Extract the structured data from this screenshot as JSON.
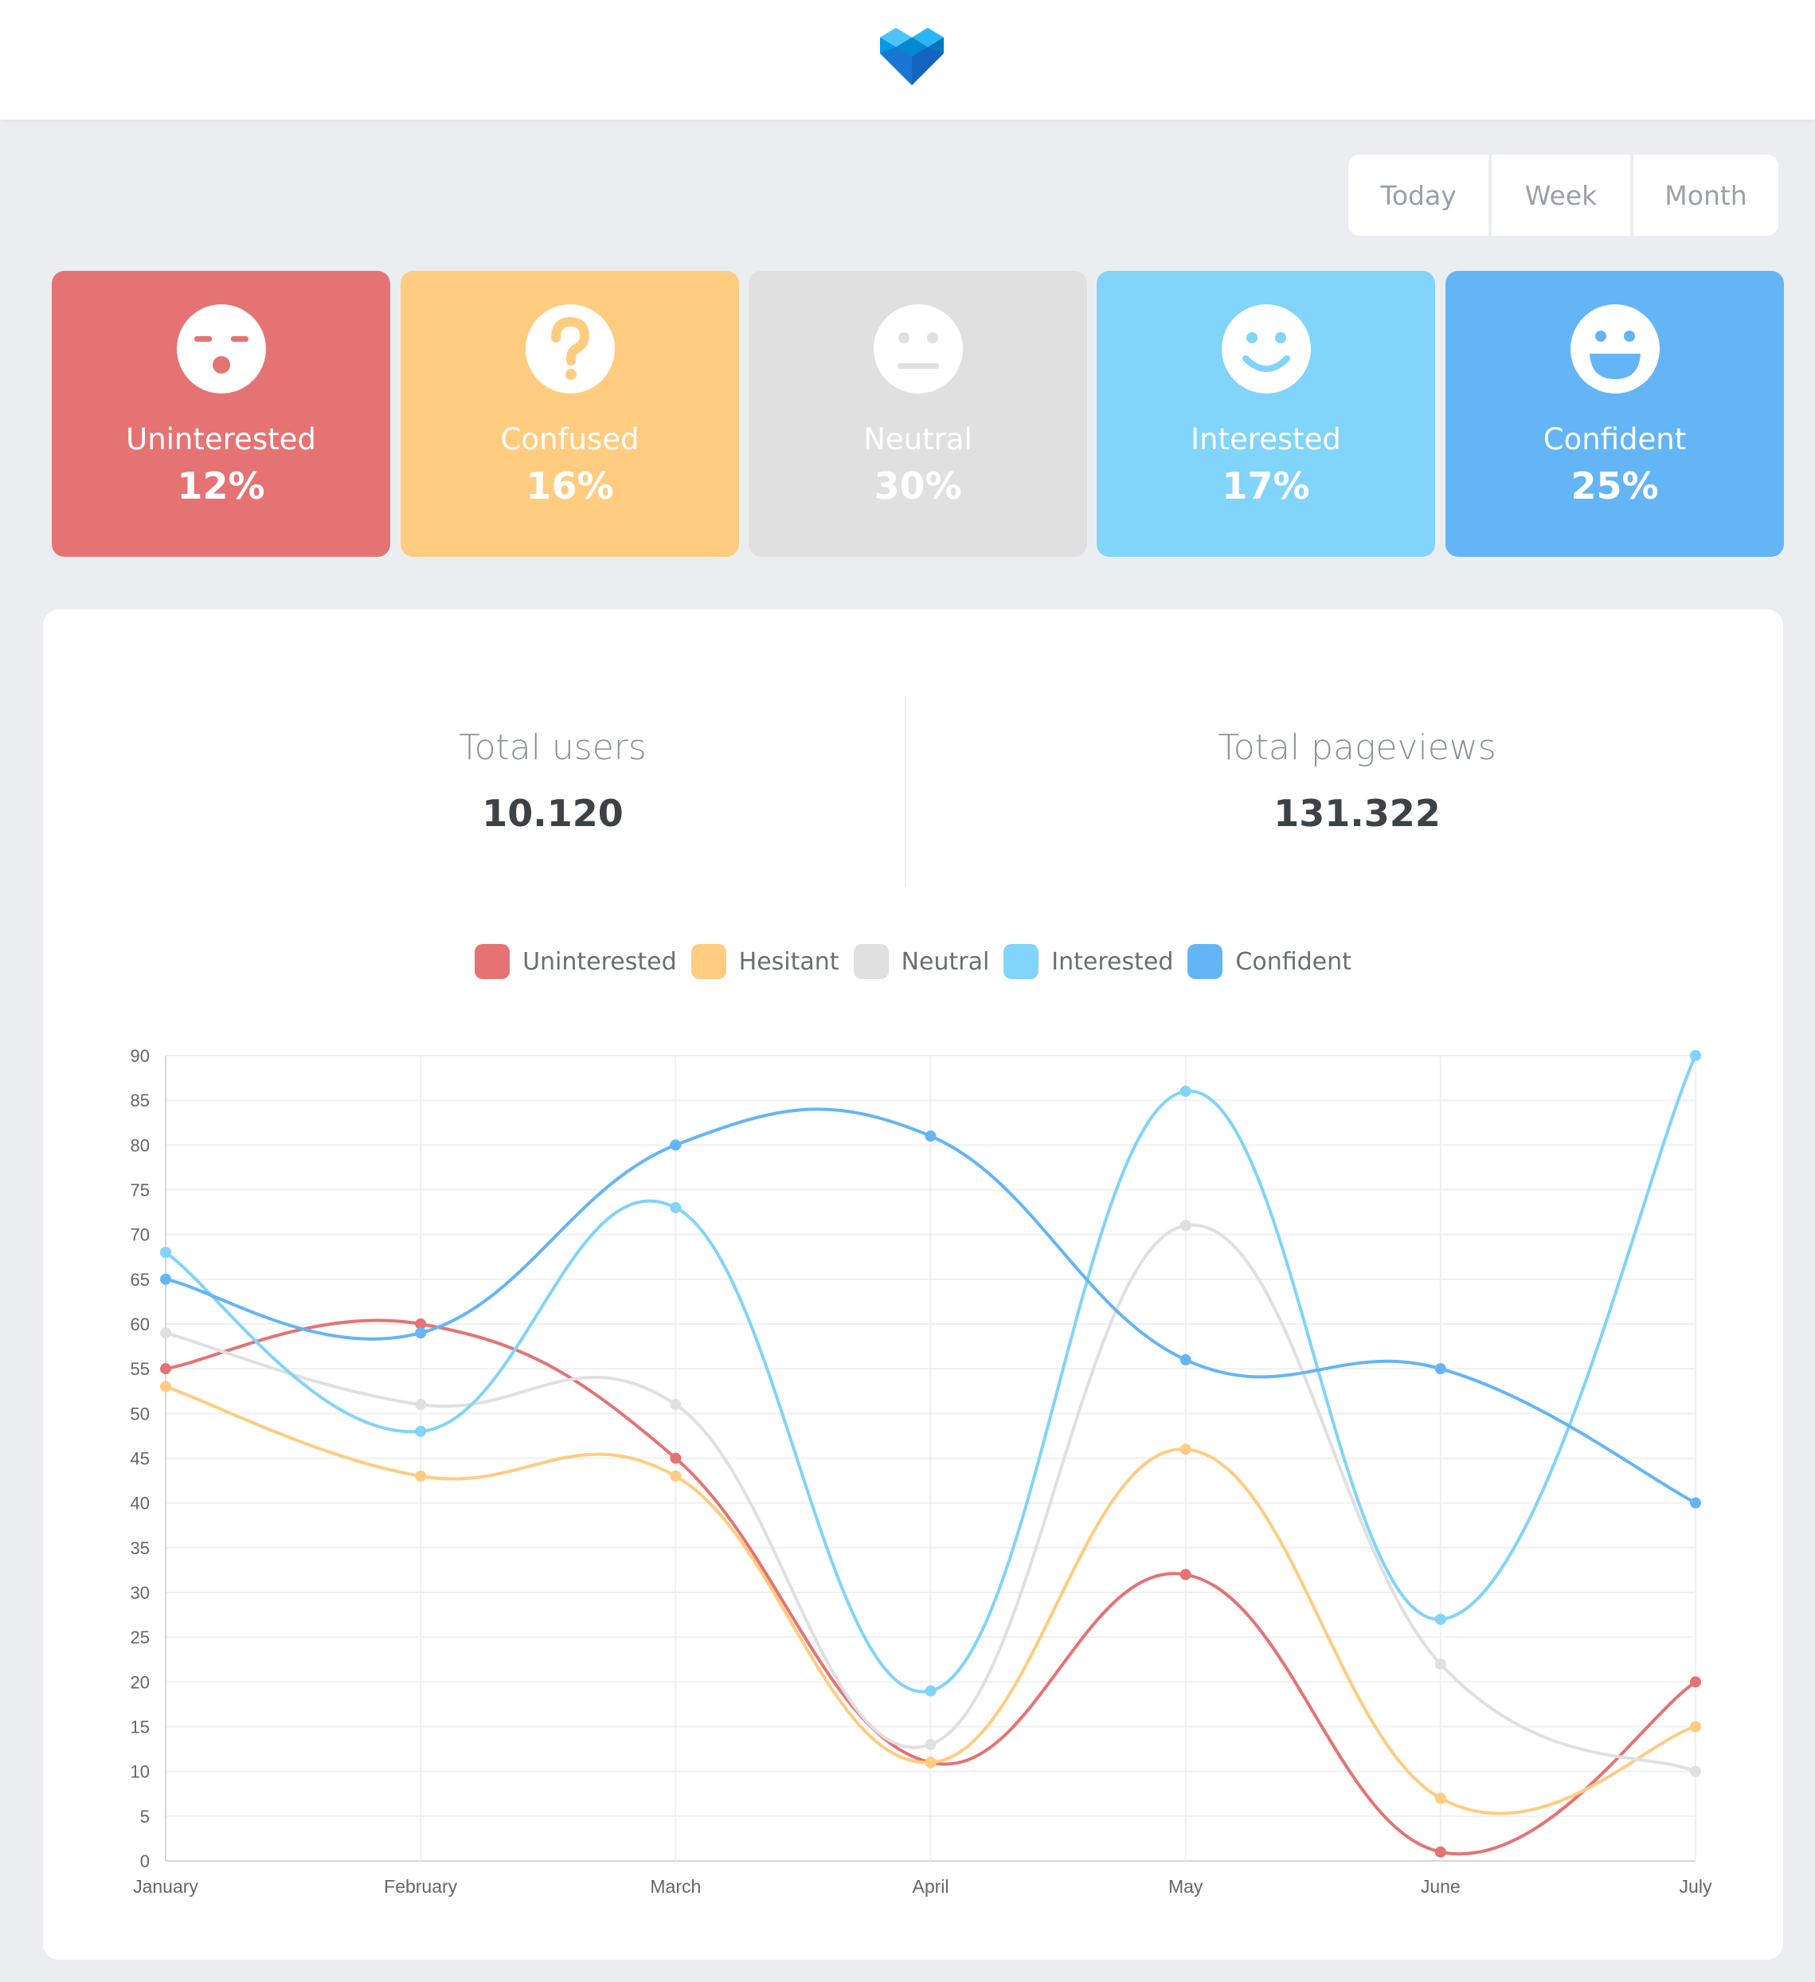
{
  "header": {
    "logo_icon": "heart-gem-logo"
  },
  "range": {
    "buttons": [
      "Today",
      "Week",
      "Month"
    ]
  },
  "cards": [
    {
      "label": "Uninterested",
      "value": "12%",
      "color": "#e57373",
      "icon": "sleepy-face-icon"
    },
    {
      "label": "Confused",
      "value": "16%",
      "color": "#ffcc80",
      "icon": "question-face-icon"
    },
    {
      "label": "Neutral",
      "value": "30%",
      "color": "#e0e0e0",
      "icon": "neutral-face-icon"
    },
    {
      "label": "Interested",
      "value": "17%",
      "color": "#81d4fa",
      "icon": "smile-face-icon"
    },
    {
      "label": "Confident",
      "value": "25%",
      "color": "#64b5f6",
      "icon": "grin-face-icon"
    }
  ],
  "stats": {
    "users_label": "Total users",
    "users_value": "10.120",
    "pageviews_label": "Total pageviews",
    "pageviews_value": "131.322"
  },
  "chart_data": {
    "type": "line",
    "categories": [
      "January",
      "February",
      "March",
      "April",
      "May",
      "June",
      "July"
    ],
    "ylim": [
      0,
      90
    ],
    "yticks": [
      0,
      5,
      10,
      15,
      20,
      25,
      30,
      35,
      40,
      45,
      50,
      55,
      60,
      65,
      70,
      75,
      80,
      85,
      90
    ],
    "grid": true,
    "legend_position": "top",
    "series": [
      {
        "name": "Uninterested",
        "color": "#e57373",
        "values": [
          55,
          60,
          45,
          11,
          32,
          1,
          20
        ]
      },
      {
        "name": "Hesitant",
        "color": "#ffcc80",
        "values": [
          53,
          43,
          43,
          11,
          46,
          7,
          15
        ]
      },
      {
        "name": "Neutral",
        "color": "#e0e0e0",
        "values": [
          59,
          51,
          51,
          13,
          71,
          22,
          10
        ]
      },
      {
        "name": "Interested",
        "color": "#81d4fa",
        "values": [
          68,
          48,
          73,
          19,
          86,
          27,
          90
        ]
      },
      {
        "name": "Confident",
        "color": "#64b5f6",
        "values": [
          65,
          59,
          80,
          81,
          56,
          55,
          40
        ]
      }
    ]
  }
}
